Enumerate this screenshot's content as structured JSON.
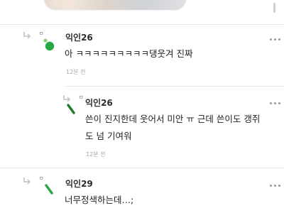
{
  "comments": [
    {
      "nickname": "익인26",
      "body": "아 ㅋㅋㅋㅋㅋㅋㅋㅋㅋ댕웃겨 진짜",
      "time": "12분 전",
      "small_mark": "ㅁ",
      "marker_icon": "green-dot-cluster-icon"
    },
    {
      "nickname": "익인26",
      "body_line1": "쓴이 진지한데 웃어서 미안 ㅠ 근데 쓴이도 갱쥐",
      "body_line2": "도 넘 기여워",
      "time": "12분 전",
      "small_mark": "ㅁ",
      "marker_icon": "green-slash-icon"
    },
    {
      "nickname": "익인29",
      "body": "너무정색하는데…;",
      "small_mark": "ㅁ",
      "marker_icon": "green-slash-icon"
    }
  ],
  "colors": {
    "accent_green": "#28a745",
    "light_green": "#8fd46a",
    "dark_green": "#1f7a2b"
  }
}
